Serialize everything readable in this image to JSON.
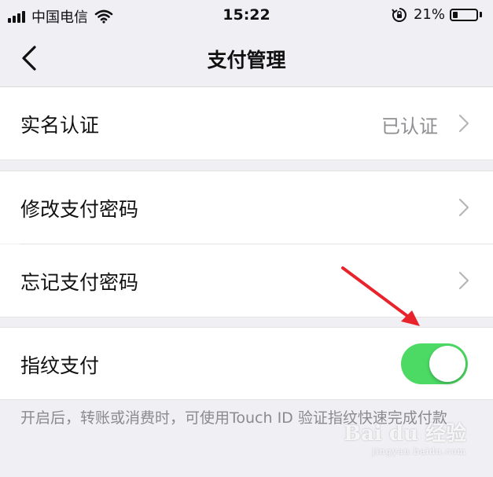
{
  "status_bar": {
    "carrier": "中国电信",
    "time": "15:22",
    "battery_percent_text": "21%",
    "battery_level": 0.21,
    "icons": [
      "signal-icon",
      "wifi-icon",
      "rotation-lock-icon",
      "battery-icon"
    ]
  },
  "nav": {
    "title": "支付管理",
    "back_icon": "chevron-left-icon"
  },
  "groups": {
    "verification": {
      "label": "实名认证",
      "value": "已认证"
    },
    "change_password": {
      "label": "修改支付密码"
    },
    "forgot_password": {
      "label": "忘记支付密码"
    },
    "fingerprint": {
      "label": "指纹支付",
      "enabled": true
    }
  },
  "footnote": "开启后，转账或消费时，可使用Touch ID 验证指纹快速完成付款",
  "overlay": {
    "annotation": "red-arrow-icon",
    "color": "#e8232b"
  },
  "watermark": {
    "logo": "Bai du 经验",
    "sub": "jingyan.baidu.com"
  },
  "colors": {
    "toggle_on": "#4cd964",
    "background": "#efeff4",
    "secondary_text": "#8e8e93"
  }
}
